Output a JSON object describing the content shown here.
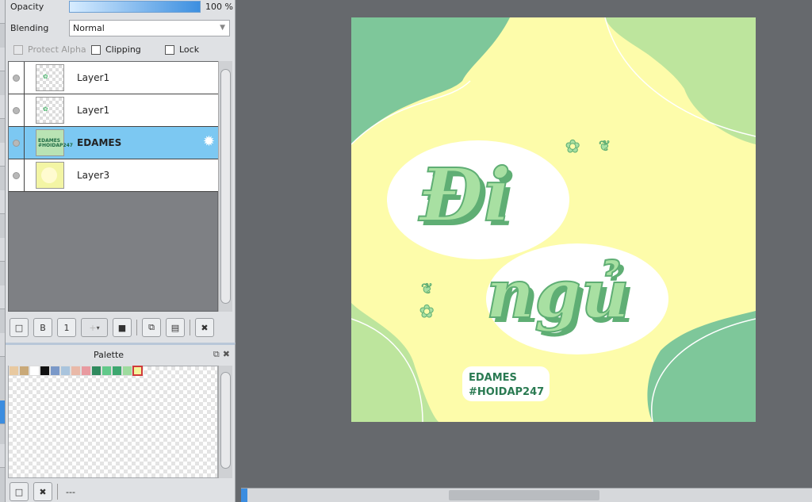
{
  "layer_props": {
    "opacity_label": "Opacity",
    "opacity_value": "100 %",
    "opacity_fraction": 1.0,
    "blending_label": "Blending",
    "blending_value": "Normal",
    "protect_alpha": "Protect Alpha",
    "clipping": "Clipping",
    "lock": "Lock"
  },
  "layers": [
    {
      "name": "Layer1",
      "selected": false
    },
    {
      "name": "Layer1",
      "selected": false
    },
    {
      "name": "EDAMES",
      "selected": true
    },
    {
      "name": "Layer3",
      "selected": false
    }
  ],
  "thumb_text": {
    "edames_thumb_line1": "EDAMES",
    "edames_thumb_line2": "#HOIDAP247"
  },
  "layer_toolbar": {
    "new": "□",
    "b_label": "B",
    "one_label": "1",
    "add": "+",
    "folder": "■",
    "copy": "⧉",
    "merge": "▤",
    "delete": "✖"
  },
  "palette": {
    "title": "Palette",
    "status": "---",
    "swatches": [
      "#e8c9a0",
      "#c9a978",
      "#ffffff",
      "#111111",
      "#7a98c8",
      "#a9c4dd",
      "#e9b9a8",
      "#e89aa0",
      "#2f8a5e",
      "#62c98a",
      "#3da76f",
      "#9edb9e",
      "#f4f49a"
    ]
  },
  "artwork": {
    "line1": "Đi",
    "line2": "ngủ",
    "tag1": "EDAMES",
    "tag2": "#HOIDAP247",
    "colors": {
      "bg_yellow": "#fdfcaa",
      "green_dark": "#7ec79a",
      "green_light": "#bde59d",
      "letter_fill": "#a8e0a2",
      "letter_shadow": "#5fae74",
      "text_dark": "#2a7a52"
    }
  }
}
